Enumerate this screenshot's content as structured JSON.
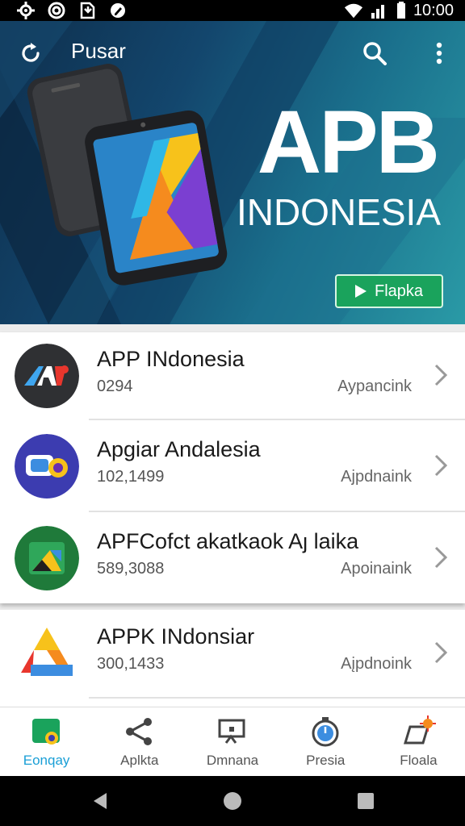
{
  "status_bar": {
    "time": "10:00",
    "left_icons": [
      "settings-gear-icon",
      "target-icon",
      "download-icon",
      "edit-icon"
    ],
    "right_icons": [
      "wifi-icon",
      "signal-icon",
      "battery-icon"
    ]
  },
  "hero": {
    "title": "Pusar",
    "brand_line1": "APB",
    "brand_line2": "INDONESIA",
    "play_label": "Flapka",
    "colors": {
      "accent_green": "#1aa35c",
      "bg_dark": "#13466d",
      "bg_teal": "#2a9aa6"
    }
  },
  "apps": [
    {
      "name": "APP INdonesia",
      "count": "0294",
      "meta": "Aypancink",
      "icon": "app-indonesia-logo-icon"
    },
    {
      "name": "Apgiar Andalesia",
      "count": "102,1499",
      "meta": "Ajpdnaink",
      "icon": "apgiar-logo-icon"
    },
    {
      "name": "APFCofct akatkaok Aȷ laika",
      "count": "589,3088",
      "meta": "Apoinaink",
      "icon": "apfcofct-logo-icon"
    },
    {
      "name": "APPK INdonsiar",
      "count": "300,1433",
      "meta": "Aįpdnoink",
      "icon": "appk-logo-icon"
    }
  ],
  "bottom_nav": [
    {
      "label": "Eonqay",
      "icon": "home-map-icon",
      "active": true
    },
    {
      "label": "Aplkta",
      "icon": "share-icon",
      "active": false
    },
    {
      "label": "Dmnana",
      "icon": "cast-icon",
      "active": false
    },
    {
      "label": "Presia",
      "icon": "stopwatch-icon",
      "active": false
    },
    {
      "label": "Floala",
      "icon": "flag-burst-icon",
      "active": false
    }
  ],
  "system_nav": [
    "back-icon",
    "home-icon",
    "recents-icon"
  ]
}
